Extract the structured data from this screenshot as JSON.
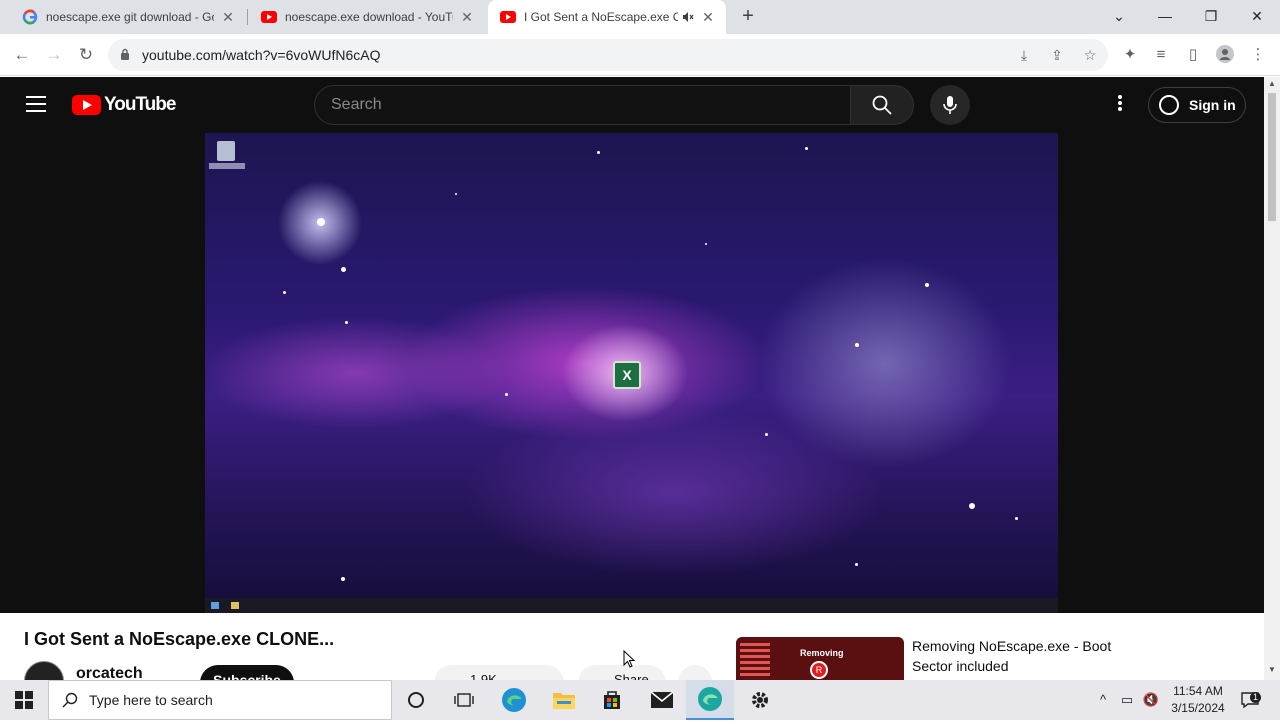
{
  "browser": {
    "tabs": [
      {
        "title": "noescape.exe git download - Go",
        "favicon": "google-favicon"
      },
      {
        "title": "noescape.exe download - YouTu",
        "favicon": "youtube-favicon"
      },
      {
        "title": "I Got Sent a NoEscape.exe C",
        "favicon": "youtube-favicon",
        "active": true,
        "audio": "muted-speaker-icon"
      }
    ],
    "url": "youtube.com/watch?v=6voWUfN6cAQ"
  },
  "youtube": {
    "logo_text": "YouTube",
    "search_placeholder": "Search",
    "sign_in": "Sign in",
    "video": {
      "title": "I Got Sent a NoEscape.exe CLONE...",
      "channel": "orcatech",
      "subscribe": "Subscribe",
      "likes": "1.9K",
      "share": "Share"
    },
    "recommendation": {
      "thumb_text": "Removing",
      "title": "Removing NoEscape.exe - Boot Sector included"
    }
  },
  "taskbar": {
    "search_placeholder": "Type here to search",
    "time": "11:54 AM",
    "date": "3/15/2024",
    "notification_count": "1"
  },
  "colors": {
    "yt_red": "#ff0000",
    "yt_bg": "#0f0f0f",
    "chrome_tabbar": "#dee1e6"
  }
}
